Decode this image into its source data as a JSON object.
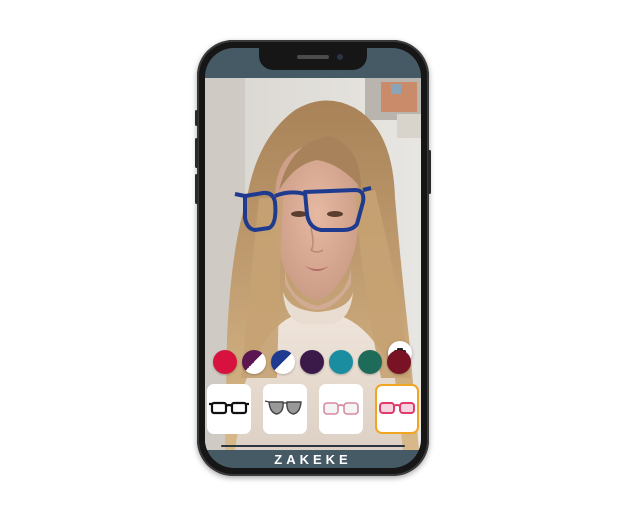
{
  "brand": {
    "logo_text": "ZAKEKE",
    "accent": "#f0a623",
    "bar_color": "#465a66"
  },
  "camera": {
    "capture_icon": "camera-icon",
    "tryon_frame_color": "#1f3b8f"
  },
  "color_swatches": [
    {
      "name": "red",
      "color": "#d8123e",
      "selected": false
    },
    {
      "name": "purple-speckle",
      "color": "#5b1550",
      "selected": false
    },
    {
      "name": "blue-speckle",
      "color": "#1f3b8f",
      "selected": true
    },
    {
      "name": "dark-purple",
      "color": "#3b1a4a",
      "selected": false
    },
    {
      "name": "teal",
      "color": "#1a8ea0",
      "selected": false
    },
    {
      "name": "green-speckle",
      "color": "#1f6b5a",
      "selected": false
    },
    {
      "name": "burgundy-speckle",
      "color": "#7a1226",
      "selected": false
    }
  ],
  "frames": [
    {
      "name": "black-rectangular-frame",
      "color": "#111111",
      "selected": false
    },
    {
      "name": "grey-aviator-frame",
      "color": "#555555",
      "selected": false
    },
    {
      "name": "pink-clear-frame",
      "color": "#d98aa0",
      "selected": false
    },
    {
      "name": "pink-red-frame",
      "color": "#e23a6a",
      "selected": true
    }
  ]
}
